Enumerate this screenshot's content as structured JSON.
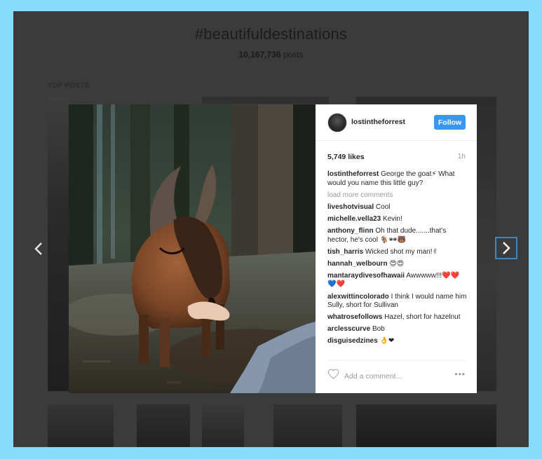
{
  "hashtag": "#beautifuldestinations",
  "post_count": "10,167,736",
  "post_count_label": " posts",
  "section_label": "TOP POSTS",
  "post": {
    "username": "lostintheforrest",
    "follow_label": "Follow",
    "likes": "5,749 likes",
    "time": "1h",
    "caption_user": "lostintheforrest",
    "caption": " George the goat⚡ What would you name this little guy?",
    "load_more": "load more comments",
    "comments": [
      {
        "user": "liveshotvisual",
        "text": " Cool"
      },
      {
        "user": "michelle.vella23",
        "text": " Kevin!"
      },
      {
        "user": "anthony_flinn",
        "text": " Oh that dude.......that's hector, he's cool 🐐🕶🐻"
      },
      {
        "user": "tish_harris",
        "text": " Wicked shot my man!✌"
      },
      {
        "user": "hannah_welbourn",
        "text": " 😍😍"
      },
      {
        "user": "mantaraydivesofhawaii",
        "text": " Awwwww!!!❤️❤️💙❤️"
      },
      {
        "user": "alexwittincolorado",
        "text": " I think I would name him Sully, short for Sullivan"
      },
      {
        "user": "whatrosefollows",
        "text": " Hazel, short for hazelnut"
      },
      {
        "user": "arclesscurve",
        "text": " Bob"
      },
      {
        "user": "disguisedzines",
        "text": " 👌❤"
      }
    ],
    "comment_placeholder": "Add a comment...",
    "more_options": "•••"
  },
  "icons": {
    "prev": "chevron-left-icon",
    "next": "chevron-right-icon",
    "like": "heart-outline-icon",
    "more": "more-options-icon"
  },
  "colors": {
    "follow_button": "#3897f0",
    "page_border": "#86dcfa",
    "overlay": "#3b3b3b",
    "next_focus": "#3b85c4"
  }
}
